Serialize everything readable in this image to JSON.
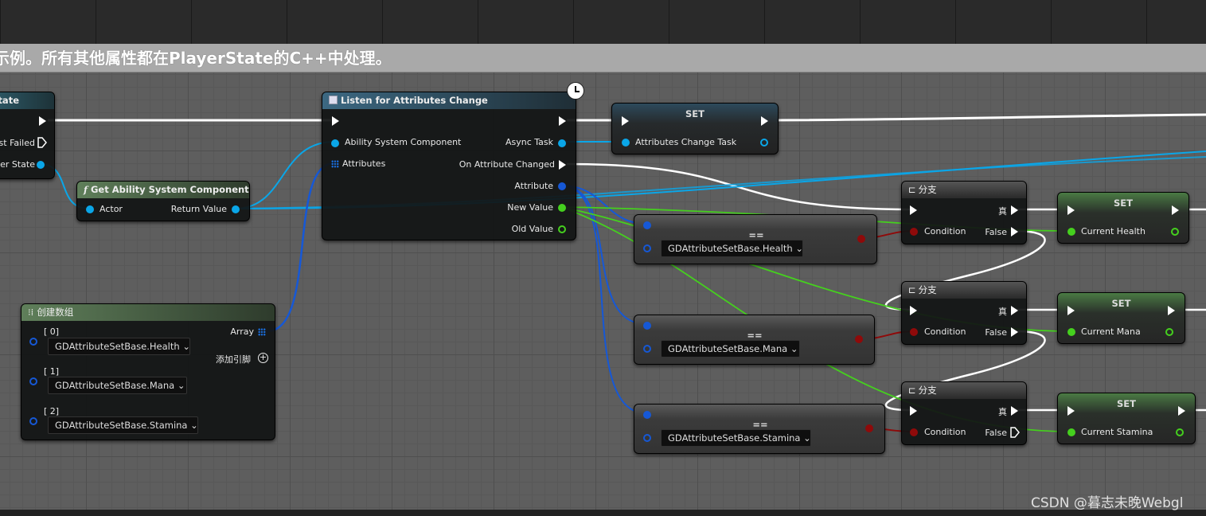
{
  "comment": {
    "text": "示例。所有其他属性都在PlayerState的C++中处理。"
  },
  "colors": {
    "exec": "#ffffff",
    "object_pin": "#0aa6e8",
    "attribute_pin": "#1658d6",
    "float_pin": "#45d01e",
    "bool_pin": "#8f0a0a",
    "graph_bg": "#5e5e5e"
  },
  "player_state_node": {
    "title": "State",
    "pins": [
      "st Failed",
      "er State"
    ]
  },
  "get_asc_node": {
    "icon": "function-icon",
    "icon_glyph": "f",
    "title": "Get Ability System Component",
    "input": "Actor",
    "output": "Return Value"
  },
  "listen_node": {
    "icon": "async-task-icon",
    "badge_icon": "clock-icon",
    "title": "Listen for Attributes Change",
    "inputs": [
      "Ability System Component",
      "Attributes"
    ],
    "outputs": [
      "Async Task",
      "On Attribute Changed",
      "Attribute",
      "New Value",
      "Old Value"
    ]
  },
  "set_task_node": {
    "title": "SET",
    "pin": "Attributes Change Task"
  },
  "make_array_node": {
    "icon": "make-array-icon",
    "title": "创建数组",
    "output": "Array",
    "add_pin": "添加引脚",
    "items": [
      {
        "index": "[ 0]",
        "value": "GDAttributeSetBase.Health"
      },
      {
        "index": "[ 1]",
        "value": "GDAttributeSetBase.Mana"
      },
      {
        "index": "[ 2]",
        "value": "GDAttributeSetBase.Stamina"
      }
    ]
  },
  "equals_nodes": [
    {
      "title": "==",
      "value": "GDAttributeSetBase.Health"
    },
    {
      "title": "==",
      "value": "GDAttributeSetBase.Mana"
    },
    {
      "title": "==",
      "value": "GDAttributeSetBase.Stamina"
    }
  ],
  "branch_nodes": [
    {
      "title": "分支",
      "condition": "Condition",
      "true_label": "真",
      "false_label": "False"
    },
    {
      "title": "分支",
      "condition": "Condition",
      "true_label": "真",
      "false_label": "False"
    },
    {
      "title": "分支",
      "condition": "Condition",
      "true_label": "真",
      "false_label": "False"
    }
  ],
  "set_nodes": [
    {
      "title": "SET",
      "pin": "Current Health"
    },
    {
      "title": "SET",
      "pin": "Current Mana"
    },
    {
      "title": "SET",
      "pin": "Current Stamina"
    }
  ],
  "watermark": "CSDN @暮志未晚Webgl"
}
